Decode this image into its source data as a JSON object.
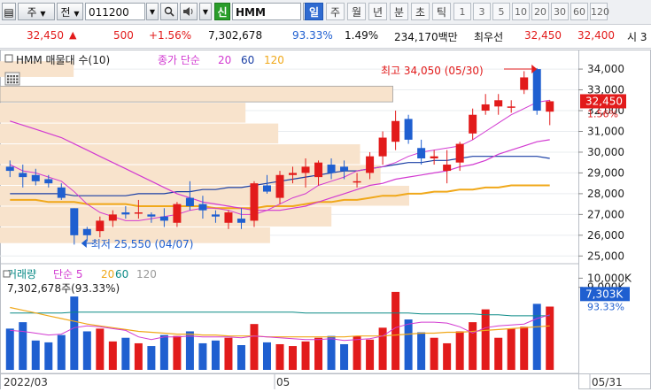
{
  "toolbar": {
    "market": "주",
    "mode": "전",
    "code": "011200",
    "search_icon": "search-icon",
    "sound_icon": "speaker-icon",
    "new_badge": "신",
    "name": "HMM",
    "close_icon": "close-icon",
    "periods": [
      "일",
      "주",
      "월",
      "년",
      "분",
      "초",
      "틱"
    ],
    "active_period": "일",
    "intervals": [
      "1",
      "3",
      "5",
      "10",
      "20",
      "30",
      "60",
      "120"
    ]
  },
  "quote": {
    "price": "32,450",
    "arrow": "▲",
    "change": "500",
    "change_pct": "+1.56%",
    "volume": "7,302,678",
    "vol_ratio": "93.33%",
    "turnover": "1.49%",
    "amount": "234,170백만",
    "quote_label": "최우선",
    "ask": "32,450",
    "bid": "32,400",
    "last": "시 3"
  },
  "colors": {
    "up": "#e21b1b",
    "down": "#1f5fd0",
    "ma5": "#d23ad1",
    "ma20": "#f0a81a",
    "ma60": "#1a3fa5",
    "ma120": "#9a9a9a",
    "profile": "#f8e3cc"
  },
  "chart_data": [
    {
      "type": "candlestick",
      "legend": [
        {
          "text": "HMM 매물대 수(10)",
          "color": "#222"
        },
        {
          "text": "종가 단순",
          "color": "#d23ad1"
        },
        {
          "text": "20",
          "color": "#d23ad1"
        },
        {
          "text": "60",
          "color": "#1a3fa5"
        },
        {
          "text": "120",
          "color": "#f0a81a"
        }
      ],
      "ylim": [
        24800,
        34600
      ],
      "y_ticks": [
        "34,000",
        "33,000",
        "32,000",
        "31,000",
        "30,000",
        "29,000",
        "28,000",
        "27,000",
        "26,000",
        "25,000"
      ],
      "y_tick_values": [
        34000,
        33000,
        32000,
        31000,
        30000,
        29000,
        28000,
        27000,
        26000,
        25000
      ],
      "candles": [
        {
          "o": 29300,
          "h": 29600,
          "l": 28800,
          "c": 29100
        },
        {
          "o": 29000,
          "h": 29400,
          "l": 28300,
          "c": 28800
        },
        {
          "o": 28900,
          "h": 29200,
          "l": 28400,
          "c": 28600
        },
        {
          "o": 28700,
          "h": 28900,
          "l": 28300,
          "c": 28500
        },
        {
          "o": 28300,
          "h": 28500,
          "l": 27700,
          "c": 27800
        },
        {
          "o": 27300,
          "h": 27300,
          "l": 25550,
          "c": 26000
        },
        {
          "o": 26300,
          "h": 26400,
          "l": 25700,
          "c": 26000
        },
        {
          "o": 26200,
          "h": 26900,
          "l": 25900,
          "c": 26700
        },
        {
          "o": 26700,
          "h": 27200,
          "l": 26400,
          "c": 27000
        },
        {
          "o": 27100,
          "h": 27400,
          "l": 26800,
          "c": 27000
        },
        {
          "o": 27100,
          "h": 27700,
          "l": 26800,
          "c": 27100
        },
        {
          "o": 27000,
          "h": 27100,
          "l": 26600,
          "c": 26900
        },
        {
          "o": 26900,
          "h": 27300,
          "l": 26400,
          "c": 26700
        },
        {
          "o": 26600,
          "h": 27600,
          "l": 26400,
          "c": 27500
        },
        {
          "o": 27800,
          "h": 28600,
          "l": 27200,
          "c": 27400
        },
        {
          "o": 27500,
          "h": 27900,
          "l": 26800,
          "c": 27200
        },
        {
          "o": 27000,
          "h": 27200,
          "l": 26600,
          "c": 26900
        },
        {
          "o": 26600,
          "h": 27200,
          "l": 26300,
          "c": 27100
        },
        {
          "o": 26800,
          "h": 27300,
          "l": 26300,
          "c": 26600
        },
        {
          "o": 26700,
          "h": 28600,
          "l": 26400,
          "c": 28500
        },
        {
          "o": 28400,
          "h": 28900,
          "l": 28000,
          "c": 28100
        },
        {
          "o": 27800,
          "h": 29100,
          "l": 27500,
          "c": 28900
        },
        {
          "o": 28900,
          "h": 29300,
          "l": 28500,
          "c": 29000
        },
        {
          "o": 29000,
          "h": 29700,
          "l": 28300,
          "c": 29300
        },
        {
          "o": 28800,
          "h": 29600,
          "l": 28400,
          "c": 29500
        },
        {
          "o": 29400,
          "h": 29700,
          "l": 28700,
          "c": 29000
        },
        {
          "o": 29300,
          "h": 29600,
          "l": 28700,
          "c": 29100
        },
        {
          "o": 28600,
          "h": 29000,
          "l": 28300,
          "c": 28600
        },
        {
          "o": 29000,
          "h": 30000,
          "l": 28700,
          "c": 29800
        },
        {
          "o": 29800,
          "h": 31000,
          "l": 29400,
          "c": 30700
        },
        {
          "o": 30500,
          "h": 32000,
          "l": 30100,
          "c": 31500
        },
        {
          "o": 31600,
          "h": 31800,
          "l": 30400,
          "c": 30600
        },
        {
          "o": 30200,
          "h": 30600,
          "l": 29400,
          "c": 29700
        },
        {
          "o": 29700,
          "h": 30100,
          "l": 29400,
          "c": 29800
        },
        {
          "o": 29100,
          "h": 30100,
          "l": 28500,
          "c": 29400
        },
        {
          "o": 29500,
          "h": 30500,
          "l": 29100,
          "c": 30400
        },
        {
          "o": 30900,
          "h": 32100,
          "l": 30600,
          "c": 31800
        },
        {
          "o": 32000,
          "h": 32800,
          "l": 31800,
          "c": 32300
        },
        {
          "o": 32200,
          "h": 32800,
          "l": 31800,
          "c": 32500
        },
        {
          "o": 32200,
          "h": 32500,
          "l": 31900,
          "c": 32200
        },
        {
          "o": 33000,
          "h": 33900,
          "l": 32800,
          "c": 33600
        },
        {
          "o": 34000,
          "h": 34050,
          "l": 31800,
          "c": 32000
        },
        {
          "o": 31950,
          "h": 32500,
          "l": 31300,
          "c": 32450
        }
      ],
      "ma5": [
        29400,
        29100,
        29000,
        28800,
        28600,
        28100,
        27500,
        27100,
        26900,
        26700,
        26700,
        26800,
        26900,
        27000,
        27200,
        27300,
        27300,
        27200,
        27000,
        27000,
        27200,
        27500,
        27800,
        28000,
        28400,
        28600,
        28800,
        29100,
        29200,
        29300,
        29500,
        29800,
        30000,
        30100,
        30200,
        30300,
        30600,
        31000,
        31400,
        31800,
        32100,
        32400,
        32500
      ],
      "ma20": [
        31500,
        31300,
        31100,
        30900,
        30700,
        30400,
        30100,
        29800,
        29500,
        29200,
        28900,
        28600,
        28300,
        28000,
        27800,
        27600,
        27500,
        27400,
        27300,
        27200,
        27200,
        27200,
        27300,
        27400,
        27600,
        27800,
        28000,
        28200,
        28400,
        28500,
        28700,
        28800,
        28900,
        29000,
        29100,
        29300,
        29400,
        29600,
        29900,
        30100,
        30300,
        30500,
        30600
      ],
      "ma60": [
        28000,
        28000,
        28000,
        28000,
        28000,
        27900,
        27900,
        27900,
        27900,
        27900,
        28000,
        28000,
        28000,
        28100,
        28100,
        28200,
        28200,
        28300,
        28300,
        28400,
        28500,
        28600,
        28700,
        28800,
        28900,
        29000,
        29100,
        29100,
        29200,
        29300,
        29400,
        29500,
        29500,
        29600,
        29600,
        29700,
        29800,
        29800,
        29800,
        29800,
        29800,
        29800,
        29700
      ],
      "ma120": [
        27700,
        27700,
        27700,
        27600,
        27600,
        27600,
        27500,
        27500,
        27500,
        27500,
        27400,
        27400,
        27400,
        27400,
        27400,
        27400,
        27300,
        27300,
        27300,
        27300,
        27400,
        27400,
        27400,
        27500,
        27600,
        27600,
        27700,
        27700,
        27800,
        27900,
        27900,
        28000,
        28000,
        28100,
        28100,
        28200,
        28200,
        28300,
        28300,
        28400,
        28400,
        28400,
        28400
      ],
      "volume_profile": [
        {
          "low": 32400,
          "high": 33200,
          "value": 96
        },
        {
          "low": 31400,
          "high": 32400,
          "value": 60
        },
        {
          "low": 30400,
          "high": 31400,
          "value": 68
        },
        {
          "low": 29400,
          "high": 30400,
          "value": 88
        },
        {
          "low": 28400,
          "high": 29400,
          "value": 93
        },
        {
          "low": 27400,
          "high": 28400,
          "value": 100
        },
        {
          "low": 26400,
          "high": 27400,
          "value": 81
        },
        {
          "low": 25600,
          "high": 26400,
          "value": 66
        },
        {
          "low": 33600,
          "high": 34400,
          "value": 18
        }
      ],
      "annotations": {
        "high": "최고 34,050 (05/30)",
        "low": "최저 25,550 (04/07)",
        "current": "32,450",
        "current_pct": "1.56%"
      }
    },
    {
      "type": "bar",
      "legend": [
        {
          "text": "거래량",
          "color": "#0a8a86"
        },
        {
          "text": "단순 5",
          "color": "#d23ad1"
        },
        {
          "text": "20",
          "color": "#f0a81a"
        },
        {
          "text": "60",
          "color": "#0a8a86"
        },
        {
          "text": "120",
          "color": "#9a9a9a"
        }
      ],
      "subtitle": "7,302,678주(93.33%)",
      "ylim": [
        0,
        11000
      ],
      "y_ticks": [
        "10,000K",
        "9,000K"
      ],
      "y_tick_values": [
        10000,
        9000
      ],
      "current": "7,303K",
      "current_pct": "93.33%",
      "volume": [
        4500,
        5200,
        3200,
        3000,
        3800,
        8000,
        4200,
        4500,
        3100,
        3500,
        2900,
        2600,
        3800,
        3700,
        4200,
        2900,
        3200,
        3500,
        2700,
        5000,
        3000,
        2800,
        2600,
        3100,
        3500,
        3700,
        2800,
        3700,
        3300,
        4600,
        8500,
        5500,
        4100,
        3500,
        2900,
        4200,
        5200,
        6600,
        3500,
        4500,
        4700,
        7200,
        6900
      ],
      "vol_ma5": [
        4300,
        4200,
        4000,
        3800,
        3900,
        4600,
        4800,
        4700,
        4500,
        4300,
        3600,
        3300,
        3600,
        3600,
        3700,
        3600,
        3600,
        3600,
        3500,
        3700,
        3600,
        3500,
        3400,
        3300,
        3300,
        3400,
        3200,
        3300,
        3400,
        3700,
        4600,
        5000,
        5200,
        5200,
        5100,
        4700,
        4000,
        4600,
        4800,
        4900,
        5000,
        5600,
        6000
      ],
      "vol_ma20": [
        6800,
        6500,
        6200,
        5900,
        5600,
        5300,
        5000,
        4800,
        4600,
        4400,
        4200,
        4100,
        4000,
        3900,
        3900,
        3800,
        3800,
        3700,
        3700,
        3700,
        3600,
        3600,
        3600,
        3600,
        3600,
        3600,
        3600,
        3700,
        3700,
        3700,
        3800,
        3900,
        4000,
        4000,
        4100,
        4100,
        4200,
        4300,
        4400,
        4500,
        4600,
        4700,
        4800
      ],
      "vol_ma60": [
        6200,
        6200,
        6200,
        6200,
        6200,
        6300,
        6300,
        6300,
        6300,
        6300,
        6300,
        6300,
        6300,
        6300,
        6300,
        6300,
        6300,
        6300,
        6300,
        6300,
        6300,
        6300,
        6300,
        6200,
        6200,
        6200,
        6200,
        6200,
        6200,
        6200,
        6200,
        6200,
        6100,
        6100,
        6100,
        6100,
        6100,
        6000,
        6000,
        5900,
        5900,
        5900,
        5900
      ],
      "x_labels": [
        {
          "text": "2022/03",
          "index": 0
        },
        {
          "text": "05",
          "index": 21
        },
        {
          "text": "05/31",
          "index": 43
        }
      ]
    }
  ]
}
